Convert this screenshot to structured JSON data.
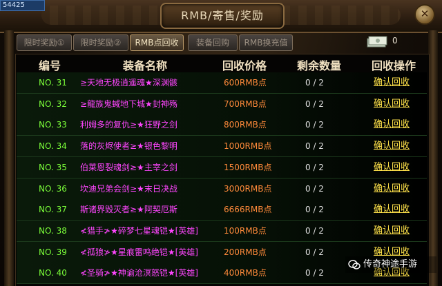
{
  "score_display": "54425",
  "window": {
    "title": "RMB/寄售/奖励",
    "close_glyph": "✕"
  },
  "tabs": [
    {
      "label": "限时奖励①",
      "active": false
    },
    {
      "label": "限时奖励②",
      "active": false
    },
    {
      "label": "RMB点回收",
      "active": true
    },
    {
      "label": "装备回购",
      "active": false
    },
    {
      "label": "RMB换充值",
      "active": false
    }
  ],
  "currency": {
    "icon": "money-stack-icon",
    "count": "0"
  },
  "table": {
    "headers": [
      "编号",
      "装备名称",
      "回收价格",
      "剩余数量",
      "回收操作"
    ],
    "rows": [
      {
        "no": "NO. 31",
        "name": "≥天地无极逍遥魂★深渊骸",
        "price": "600RMB点",
        "remain": "0 / 2",
        "action": "确认回收"
      },
      {
        "no": "NO. 32",
        "name": "≥龍族鬼蜮地下城★封神殇",
        "price": "700RMB点",
        "remain": "0 / 2",
        "action": "确认回收"
      },
      {
        "no": "NO. 33",
        "name": "利姆多的复仇≥★狂野之剑",
        "price": "800RMB点",
        "remain": "0 / 2",
        "action": "确认回收"
      },
      {
        "no": "NO. 34",
        "name": "落的灰烬使者≥★银色黎明",
        "price": "1000RMB点",
        "remain": "0 / 2",
        "action": "确认回收"
      },
      {
        "no": "NO. 35",
        "name": "伯莱恩裂魂剑≥★主宰之剑",
        "price": "1500RMB点",
        "remain": "0 / 2",
        "action": "确认回收"
      },
      {
        "no": "NO. 36",
        "name": "坎迪兄弟会剑≥★末日决战",
        "price": "3000RMB点",
        "remain": "0 / 2",
        "action": "确认回收"
      },
      {
        "no": "NO. 37",
        "name": "斯诸界毁灭者≥★阿契厄斯",
        "price": "6666RMB点",
        "remain": "0 / 2",
        "action": "确认回收"
      },
      {
        "no": "NO. 38",
        "name": "≮猎手≯★碎梦七星魂铠★[英雄]",
        "price": "100RMB点",
        "remain": "0 / 2",
        "action": "确认回收"
      },
      {
        "no": "NO. 39",
        "name": "≮孤狼≯★星痕雷鸣绝铠★[英雄]",
        "price": "200RMB点",
        "remain": "0 / 2",
        "action": "确认回收"
      },
      {
        "no": "NO. 40",
        "name": "≮圣骑≯★神谕沧溟怒铠★[英雄]",
        "price": "400RMB点",
        "remain": "0 / 2",
        "action": "确认回收"
      }
    ]
  },
  "watermark": {
    "icon": "wechat-icon",
    "text": "传奇神途手游"
  },
  "colors": {
    "number": "#7cff3a",
    "name": "#ff46ff",
    "price": "#ff8a3a",
    "action": "#ffe24a"
  }
}
